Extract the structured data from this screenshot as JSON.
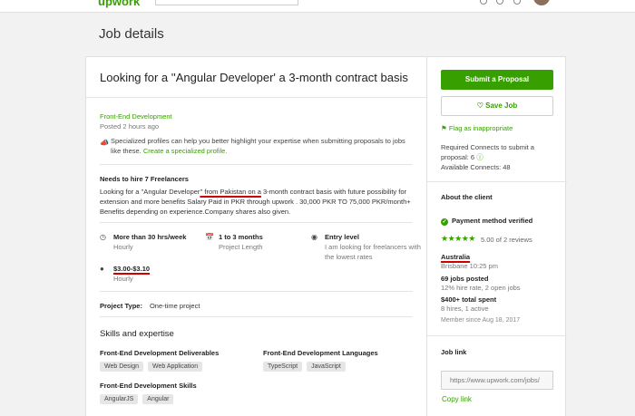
{
  "topbar": {
    "logo": "upwork",
    "search_placeholder": ""
  },
  "page_heading": "Job details",
  "job": {
    "title": "Looking for a ''Angular Developer' a 3-month contract basis",
    "category": "Front-End Development",
    "posted": "Posted 2 hours ago",
    "specialized_text": "Specialized profiles can help you better highlight your expertise when submitting proposals to jobs like these.",
    "specialized_link": "Create a specialized profile.",
    "needs": "Needs to hire 7 Freelancers",
    "description_before": "Looking for a ''Angular Developer",
    "description_underlined": "'' from Pakistan on a",
    "description_after": " 3-month contract basis with future possibility for extension and more benefits Salary Paid in PKR through upwork . 30,000 PKR TO 75,000 PKR/month+ Benefits depending on experience.Company shares also given.",
    "meta": {
      "hours_title": "More than 30 hrs/week",
      "hours_sub": "Hourly",
      "length_title": "1 to 3 months",
      "length_sub": "Project Length",
      "level_title": "Entry level",
      "level_sub": "I am looking for freelancers with the lowest rates",
      "rate_title": "$3.00-$3.10",
      "rate_sub": "Hourly"
    },
    "project_type_label": "Project Type:",
    "project_type_value": "One-time project",
    "skills_heading": "Skills and expertise",
    "skill_groups": [
      {
        "title": "Front-End Development Deliverables",
        "tags": [
          "Web Design",
          "Web Application"
        ]
      },
      {
        "title": "Front-End Development Languages",
        "tags": [
          "TypeScript",
          "JavaScript"
        ]
      },
      {
        "title": "Front-End Development Skills",
        "tags": [
          "AngularJS",
          "Angular"
        ]
      }
    ]
  },
  "sidebar": {
    "submit_label": "Submit a Proposal",
    "save_label": "Save Job",
    "flag_label": "Flag as inappropriate",
    "connects_required": "Required Connects to submit a proposal: 6",
    "connects_available": "Available Connects: 48",
    "about_client": "About the client",
    "payment_verified": "Payment method verified",
    "rating_stars": 5,
    "rating_text": "5.00 of 2 reviews",
    "country": "Australia",
    "city_time": "Brisbane 10:25 pm",
    "jobs_posted": "69 jobs posted",
    "hire_rate": "12% hire rate, 2 open jobs",
    "total_spent": "$400+ total spent",
    "hires": "8 hires, 1 active",
    "member_since": "Member since Aug 18, 2017",
    "job_link_title": "Job link",
    "job_link_value": "https://www.upwork.com/jobs/",
    "copy_link": "Copy link"
  },
  "colors": {
    "brand_green": "#37a000",
    "annotation_red": "#d00000"
  }
}
